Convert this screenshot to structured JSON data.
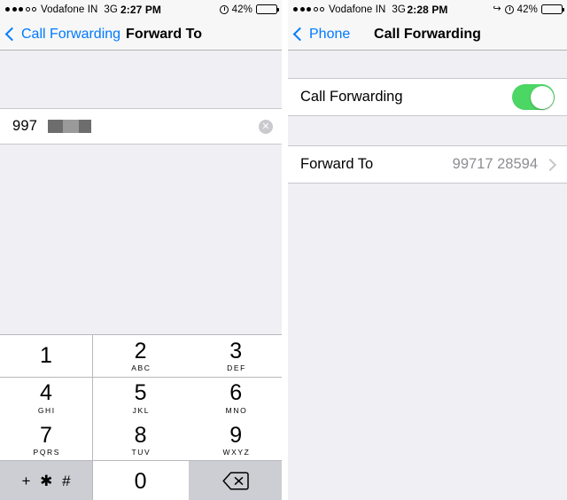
{
  "left_screen": {
    "status_bar": {
      "signal_dots_filled": 3,
      "signal_dots_empty": 2,
      "carrier": "Vodafone IN",
      "network": "3G",
      "time": "2:27 PM",
      "battery_percent": "42%",
      "battery_level": 42,
      "icons": [
        "alarm-icon",
        "battery-icon"
      ]
    },
    "nav_bar": {
      "back_label": "Call Forwarding",
      "title": "Forward To",
      "back_icon": "chevron-left-icon"
    },
    "number_field": {
      "value": "997",
      "redacted": true,
      "clear_icon": "clear-circle-icon",
      "clear_glyph": "✕"
    },
    "keypad": {
      "keys": [
        {
          "digit": "1",
          "letters": ""
        },
        {
          "digit": "2",
          "letters": "ABC"
        },
        {
          "digit": "3",
          "letters": "DEF"
        },
        {
          "digit": "4",
          "letters": "GHI"
        },
        {
          "digit": "5",
          "letters": "JKL"
        },
        {
          "digit": "6",
          "letters": "MNO"
        },
        {
          "digit": "7",
          "letters": "PQRS"
        },
        {
          "digit": "8",
          "letters": "TUV"
        },
        {
          "digit": "9",
          "letters": "WXYZ"
        }
      ],
      "symbols_key": "+ ✱ #",
      "zero_key": "0",
      "delete_key_icon": "backspace-delete-icon"
    }
  },
  "right_screen": {
    "status_bar": {
      "signal_dots_filled": 3,
      "signal_dots_empty": 2,
      "carrier": "Vodafone IN",
      "network": "3G",
      "time": "2:28 PM",
      "battery_percent": "42%",
      "battery_level": 42,
      "icons": [
        "call-forwarding-icon",
        "alarm-icon",
        "battery-icon"
      ],
      "call_forwarding_glyph": "↪"
    },
    "nav_bar": {
      "back_label": "Phone",
      "title": "Call Forwarding",
      "back_icon": "chevron-left-icon"
    },
    "rows": {
      "call_forwarding": {
        "label": "Call Forwarding",
        "toggle_on": true
      },
      "forward_to": {
        "label": "Forward To",
        "value": "99717 28594",
        "chevron_icon": "chevron-right-icon"
      }
    }
  },
  "colors": {
    "ios_blue": "#007aff",
    "toggle_green": "#4cd764",
    "group_bg": "#efeff4",
    "cell_bg": "#ffffff",
    "separator": "#c8c7cc",
    "value_gray": "#8e8e93",
    "key_shaded": "#ccced3"
  }
}
